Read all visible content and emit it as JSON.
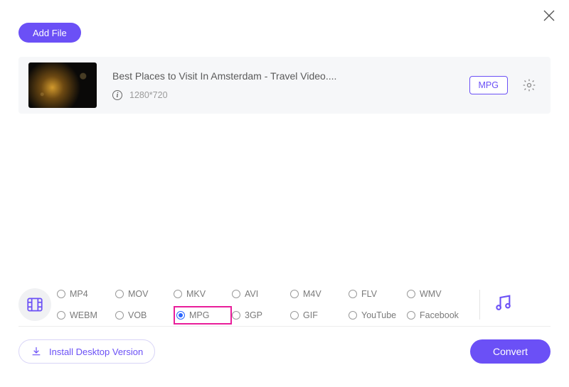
{
  "close_label": "Close",
  "add_file": "Add File",
  "file": {
    "title": "Best Places to Visit In Amsterdam - Travel Video....",
    "dimensions": "1280*720",
    "format_tag": "MPG"
  },
  "formats": {
    "items": [
      {
        "label": "MP4",
        "checked": false
      },
      {
        "label": "MOV",
        "checked": false
      },
      {
        "label": "MKV",
        "checked": false
      },
      {
        "label": "AVI",
        "checked": false
      },
      {
        "label": "M4V",
        "checked": false
      },
      {
        "label": "FLV",
        "checked": false
      },
      {
        "label": "WMV",
        "checked": false
      },
      {
        "label": "WEBM",
        "checked": false
      },
      {
        "label": "VOB",
        "checked": false
      },
      {
        "label": "MPG",
        "checked": true,
        "highlight": true
      },
      {
        "label": "3GP",
        "checked": false
      },
      {
        "label": "GIF",
        "checked": false
      },
      {
        "label": "YouTube",
        "checked": false
      },
      {
        "label": "Facebook",
        "checked": false
      }
    ]
  },
  "install_label": "Install Desktop Version",
  "convert_label": "Convert"
}
